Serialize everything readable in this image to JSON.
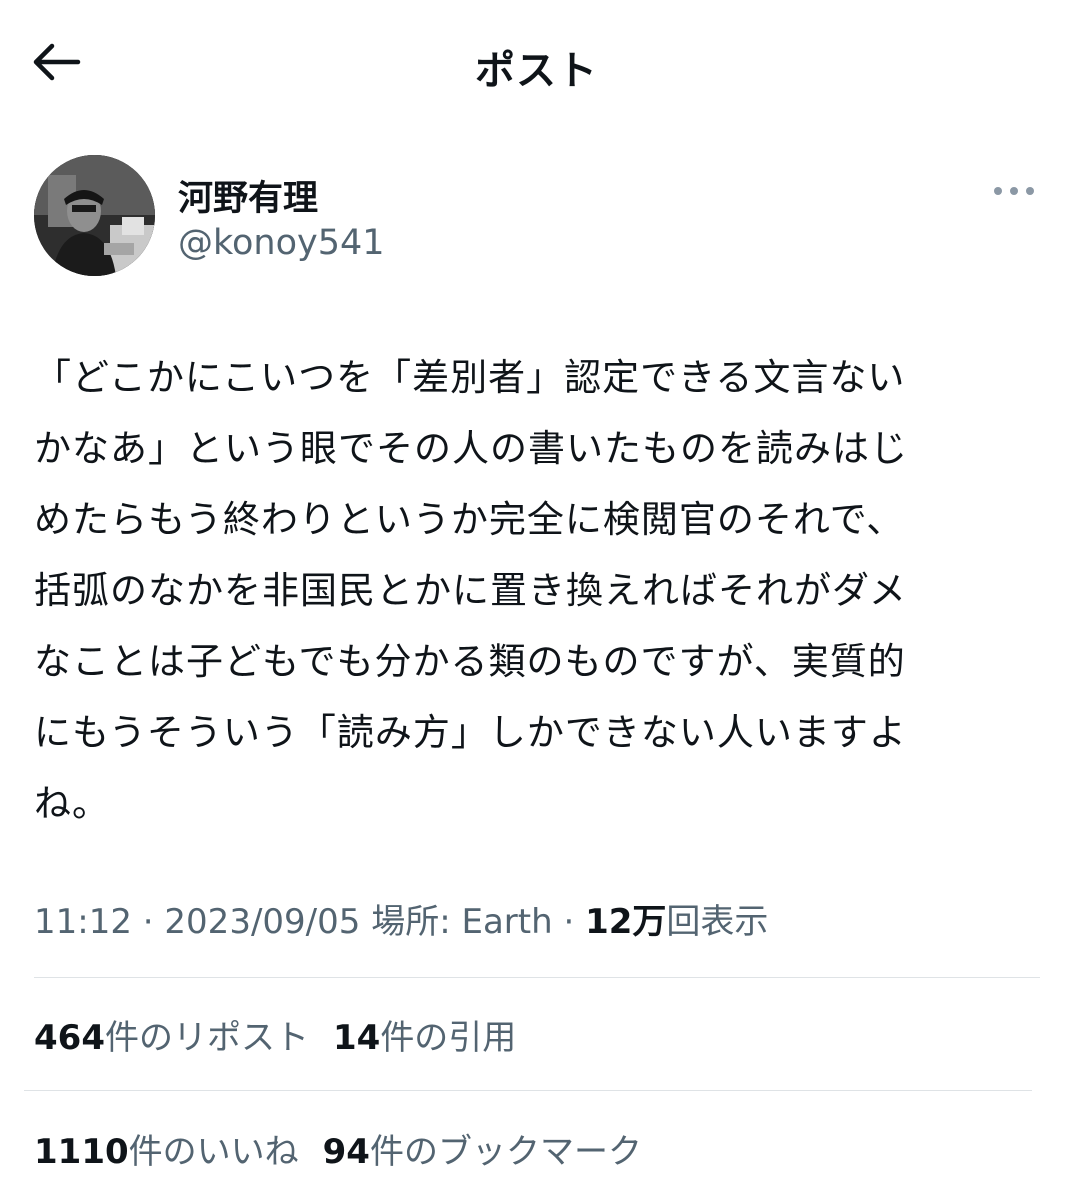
{
  "header": {
    "title": "ポスト",
    "back_icon": "arrow-left-icon"
  },
  "author": {
    "display_name": "河野有理",
    "handle": "@konoy541",
    "more_icon": "more-horizontal-icon"
  },
  "tweet": {
    "text": "「どこかにこいつを「差別者」認定できる文言ない\nかなあ」という眼でその人の書いたものを読みはじ\nめたらもう終わりというか完全に検閲官のそれで、\n括弧のなかを非国民とかに置き換えればそれがダメ\nなことは子どもでも分かる類のものですが、実質的\nにもうそういう「読み方」しかできない人いますよ\nね。"
  },
  "meta": {
    "time": "11:12",
    "sep1": " · ",
    "date": "2023/09/05",
    "location_label": "場所: Earth",
    "sep2": " · ",
    "views_count": "12万",
    "views_label": "回表示"
  },
  "stats": {
    "reposts_count": "464",
    "reposts_label": "件のリポスト",
    "quotes_count": "14",
    "quotes_label": "件の引用",
    "likes_count": "1110",
    "likes_label": "件のいいね",
    "bookmarks_count": "94",
    "bookmarks_label": "件のブックマーク"
  },
  "colors": {
    "text": "#0f1419",
    "secondary": "#536471",
    "divider": "#dfe3e6",
    "background": "#ffffff"
  }
}
